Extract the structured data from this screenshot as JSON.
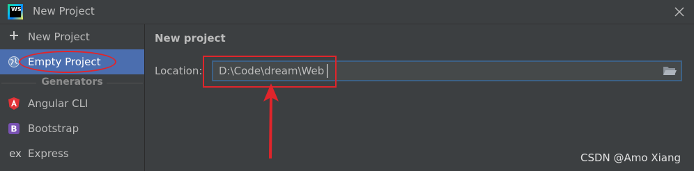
{
  "window": {
    "title": "New Project",
    "logo_text": "WS"
  },
  "sidebar": {
    "items": [
      {
        "label": "New Project",
        "icon": "plus-icon"
      },
      {
        "label": "Empty Project",
        "icon": "globe-icon",
        "selected": true
      }
    ],
    "generators_header": "Generators",
    "generators": [
      {
        "label": "Angular CLI",
        "icon": "angular-icon"
      },
      {
        "label": "Bootstrap",
        "icon": "bootstrap-icon"
      },
      {
        "label": "Express",
        "icon": "express-icon",
        "icon_text": "ex"
      }
    ]
  },
  "main": {
    "heading": "New project",
    "location_label": "Location:",
    "location_value": "D:\\Code\\dream\\Web"
  },
  "watermark": "CSDN @Amo Xiang",
  "colors": {
    "selected_bg": "#4b6eaf",
    "annotation_red": "#e0252b",
    "input_border": "#3d6185"
  }
}
